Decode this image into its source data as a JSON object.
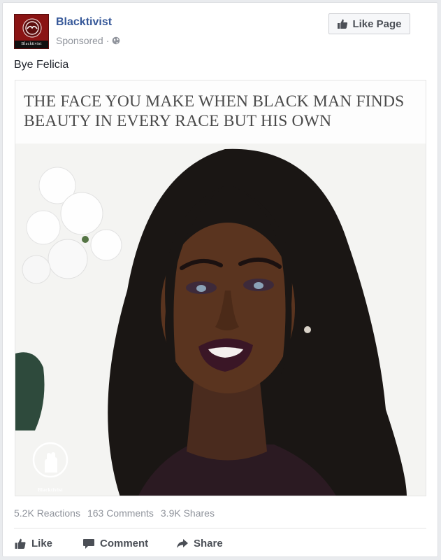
{
  "post": {
    "page_name": "Blacktivist",
    "avatar_label": "Blacktivist",
    "sponsored_label": "Sponsored",
    "sponsored_separator": "·",
    "like_page_label": "Like Page",
    "caption": "Bye Felicia"
  },
  "image": {
    "headline": "THE FACE YOU MAKE WHEN BLACK MAN FINDS BEAUTY IN EVERY RACE BUT HIS OWN",
    "watermark": "Blacktivist"
  },
  "stats": {
    "reactions": "5.2K Reactions",
    "comments": "163 Comments",
    "shares": "3.9K Shares"
  },
  "actions": {
    "like": "Like",
    "comment": "Comment",
    "share": "Share"
  },
  "colors": {
    "brand_link": "#365899",
    "secondary_text": "#90949c",
    "action_text": "#4b4f56",
    "card_border": "#dddfe2"
  },
  "icons": [
    "globe-icon",
    "thumbs-up-icon",
    "comment-icon",
    "share-arrow-icon",
    "fist-icon"
  ]
}
